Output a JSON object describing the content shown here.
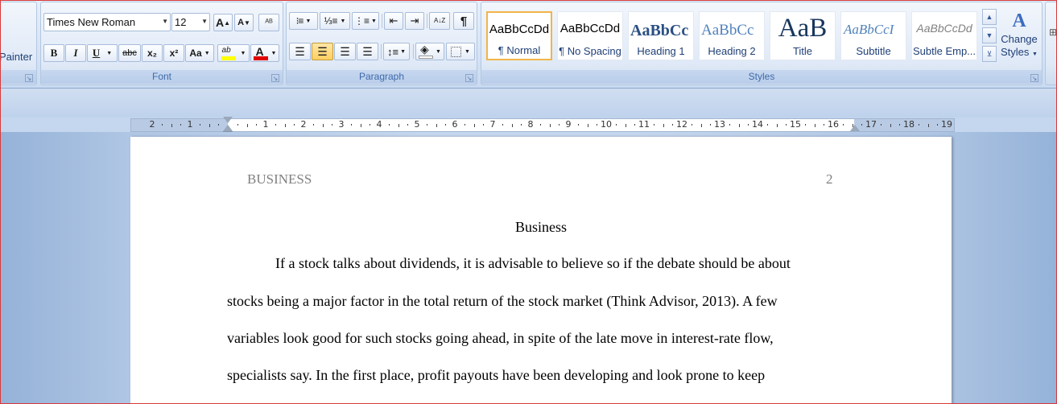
{
  "clipboard": {
    "format_painter_label": "Painter"
  },
  "font": {
    "group_label": "Font",
    "font_name": "Times New Roman",
    "font_size": "12",
    "grow_label": "A",
    "shrink_label": "A",
    "clear_label": "ᴬᴮ",
    "bold_label": "B",
    "italic_label": "I",
    "underline_label": "U",
    "strike_label": "abc",
    "subscript_label": "x₂",
    "superscript_label": "x²",
    "case_label": "Aa",
    "highlight_label": "ab",
    "fontcolor_label": "A",
    "highlight_color": "#ffff00",
    "fontcolor_color": "#e00000"
  },
  "paragraph": {
    "group_label": "Paragraph",
    "pilcrow_label": "¶",
    "sort_label": "A↓Z"
  },
  "styles": {
    "group_label": "Styles",
    "tiles": [
      {
        "sample": "AaBbCcDd",
        "name": "¶ Normal"
      },
      {
        "sample": "AaBbCcDd",
        "name": "¶ No Spacing"
      },
      {
        "sample": "AaBbCc",
        "name": "Heading 1"
      },
      {
        "sample": "AaBbCc",
        "name": "Heading 2"
      },
      {
        "sample": "AaB",
        "name": "Title"
      },
      {
        "sample": "AaBbCcI",
        "name": "Subtitle"
      },
      {
        "sample": "AaBbCcDd",
        "name": "Subtle Emp..."
      }
    ],
    "change_styles_label_1": "Change",
    "change_styles_label_2": "Styles"
  },
  "ruler": {
    "labels": [
      "2",
      "1",
      "",
      "1",
      "2",
      "3",
      "4",
      "5",
      "6",
      "7",
      "8",
      "9",
      "10",
      "11",
      "12",
      "13",
      "14",
      "15",
      "16",
      "17",
      "18",
      "19"
    ]
  },
  "document": {
    "header_text": "BUSINESS",
    "page_number": "2",
    "title": "Business",
    "lines": [
      "If a stock talks about dividends, it is advisable to believe so if the debate should be about",
      "stocks being a major factor in the total return of the stock market (Think Advisor, 2013). A few",
      "variables look good for such stocks going ahead, in spite of the late move in interest-rate flow,",
      "specialists say. In the first place, profit payouts have been developing and look prone to keep"
    ]
  }
}
